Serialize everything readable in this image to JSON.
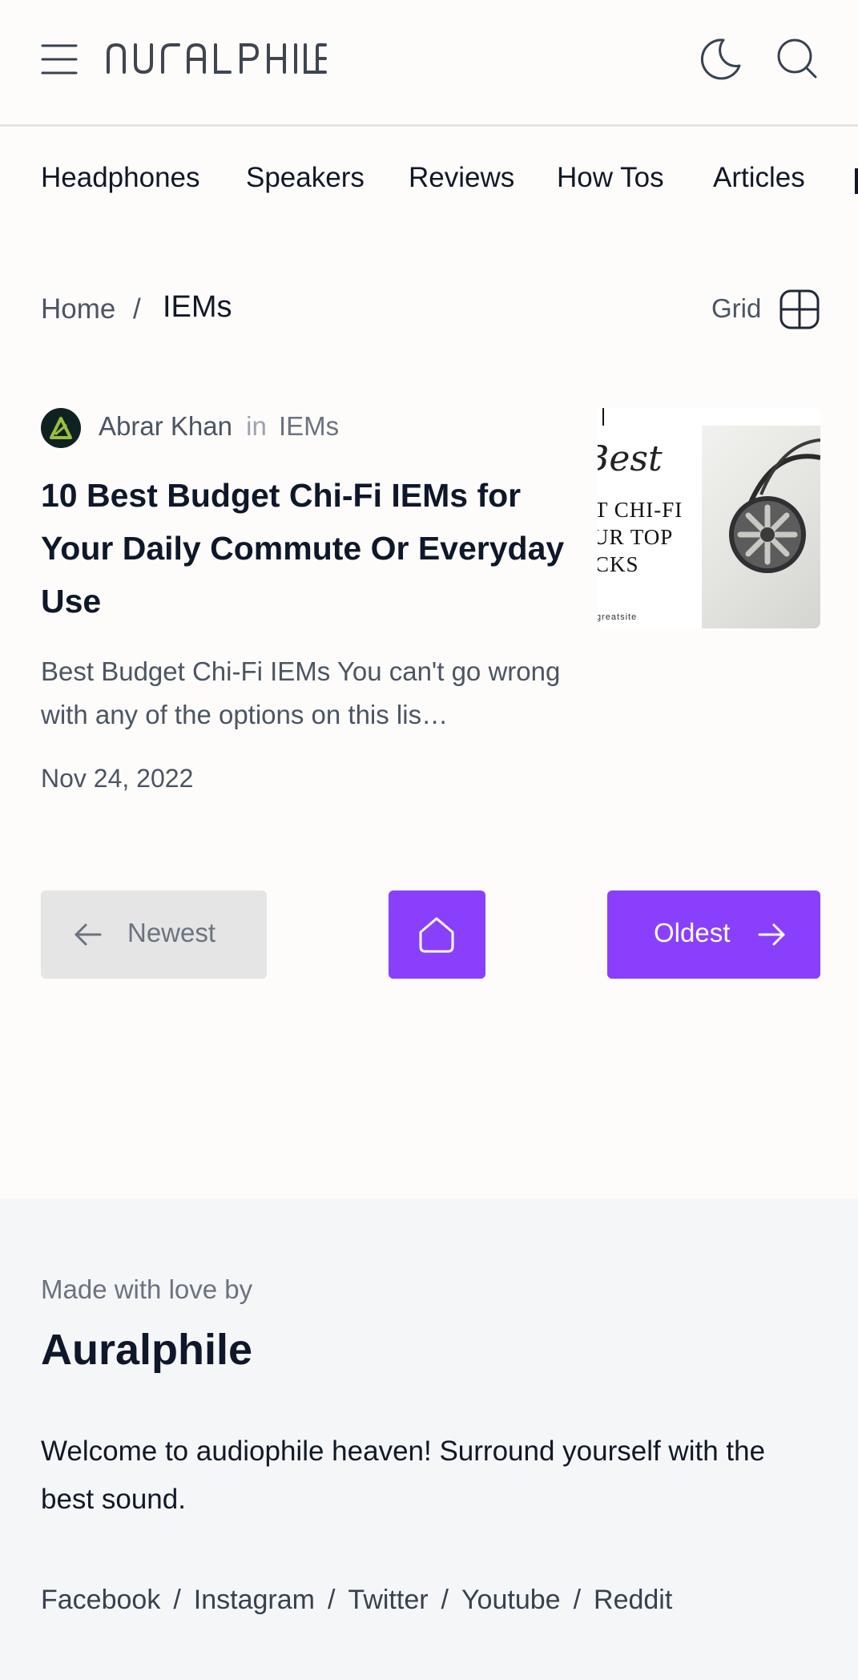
{
  "header": {
    "logo_text": "AURALPHILE",
    "icons": {
      "menu": "hamburger-icon",
      "theme": "moon-icon",
      "search": "search-icon"
    }
  },
  "category_nav": [
    "Headphones",
    "Speakers",
    "Reviews",
    "How Tos",
    "Articles"
  ],
  "breadcrumb": {
    "home": "Home",
    "separator": "/",
    "current": "IEMs"
  },
  "view_toggle": {
    "label": "Grid",
    "icon": "grid-icon"
  },
  "post": {
    "author": "Abrar Khan",
    "in_word": "in",
    "category": "IEMs",
    "title": "10 Best Budget Chi-Fi IEMs for Your Daily Commute Or Everyday Use",
    "excerpt": "Best Budget Chi-Fi IEMs You can't go wrong with any of the options on this lis…",
    "date": "Nov 24, 2022",
    "thumbnail": {
      "script_text": "Best",
      "lines": [
        "T CHI-FI",
        "UR TOP",
        "CKS"
      ],
      "site_text": "greatsite"
    }
  },
  "pagination": {
    "newest": "Newest",
    "oldest": "Oldest",
    "home_icon": "home-icon"
  },
  "footer": {
    "made_with": "Made with love by",
    "brand": "Auralphile",
    "tagline": "Welcome to audiophile heaven! Surround yourself with the best sound.",
    "social": [
      "Facebook",
      "Instagram",
      "Twitter",
      "Youtube",
      "Reddit"
    ],
    "social_separator": "/"
  },
  "colors": {
    "accent": "#8a3ffc",
    "disabled_bg": "#e5e5e5",
    "footer_bg": "#f5f6f7",
    "page_bg": "#fdfcfb"
  }
}
